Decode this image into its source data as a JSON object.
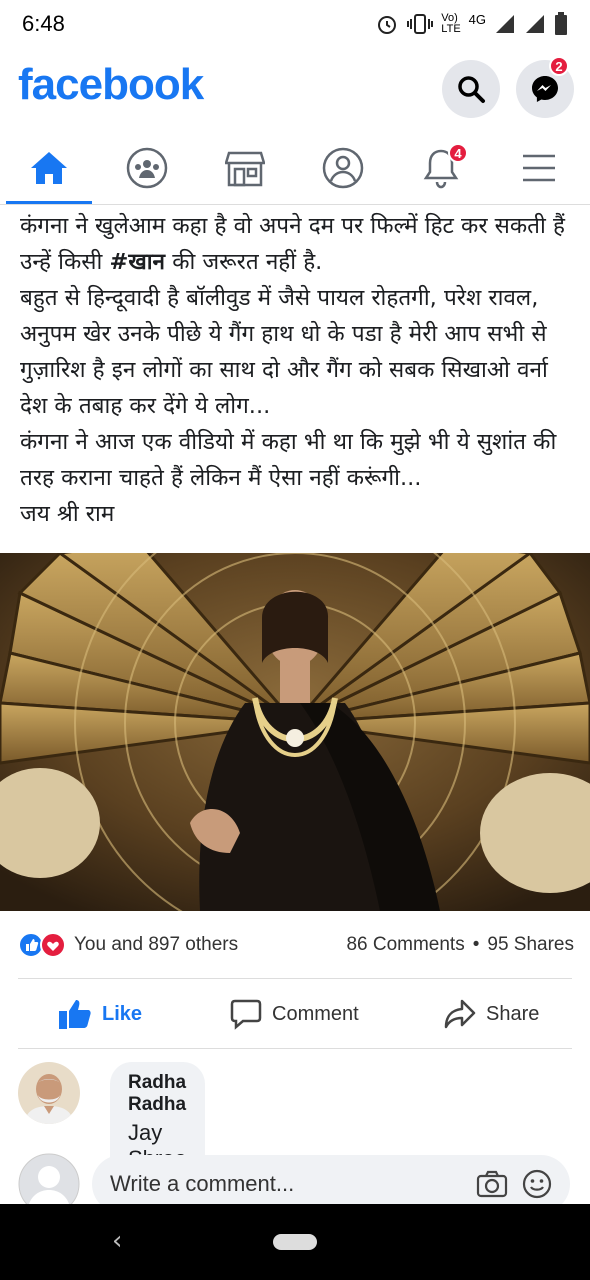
{
  "status_bar": {
    "time": "6:48",
    "network_top": "Vo)",
    "network_bottom": "LTE",
    "signal_label": "4G"
  },
  "header": {
    "logo": "facebook",
    "messenger_badge": "2"
  },
  "tabs": [
    {
      "name": "home",
      "icon": "home-icon",
      "active": true
    },
    {
      "name": "groups",
      "icon": "groups-icon"
    },
    {
      "name": "marketplace",
      "icon": "marketplace-icon"
    },
    {
      "name": "profile",
      "icon": "profile-icon"
    },
    {
      "name": "notifications",
      "icon": "bell-icon",
      "badge": "4"
    },
    {
      "name": "menu",
      "icon": "menu-icon"
    }
  ],
  "post": {
    "text_line1_a": "कंगना ने खुलेआम कहा है वो अपने दम पर फिल्में हिट कर सकती हैं उन्हें किसी ",
    "text_line1_bold": "#खान",
    "text_line1_b": " की जरूरत नहीं है.",
    "text_para2": "बहुत से हिन्दूवादी है बॉलीवुड में जैसे पायल रोहतगी, परेश रावल, अनुपम खेर उनके पीछे ये गैंग हाथ धो के पडा है मेरी आप सभी से गुज़ारिश है इन लोगों का साथ दो और गैंग को सबक सिखाओ वर्ना देश के तबाह कर देंगे ये लोग...",
    "text_para3": "कंगना ने आज एक वीडियो में कहा भी था कि मुझे भी ये सुशांत की तरह कराना चाहते हैं लेकिन मैं ऐसा नहीं करूंगी...",
    "text_para4": "जय श्री राम"
  },
  "reactions": {
    "summary": "You and 897 others",
    "comments": "86 Comments",
    "separator": "•",
    "shares": "95 Shares"
  },
  "actions": {
    "like": "Like",
    "comment": "Comment",
    "share": "Share"
  },
  "comments": [
    {
      "author": "Radha Radha",
      "text": "Jay Shree Ram"
    }
  ],
  "composer": {
    "placeholder": "Write a comment..."
  },
  "colors": {
    "brand": "#1877f2",
    "badge": "#e41e3f"
  }
}
